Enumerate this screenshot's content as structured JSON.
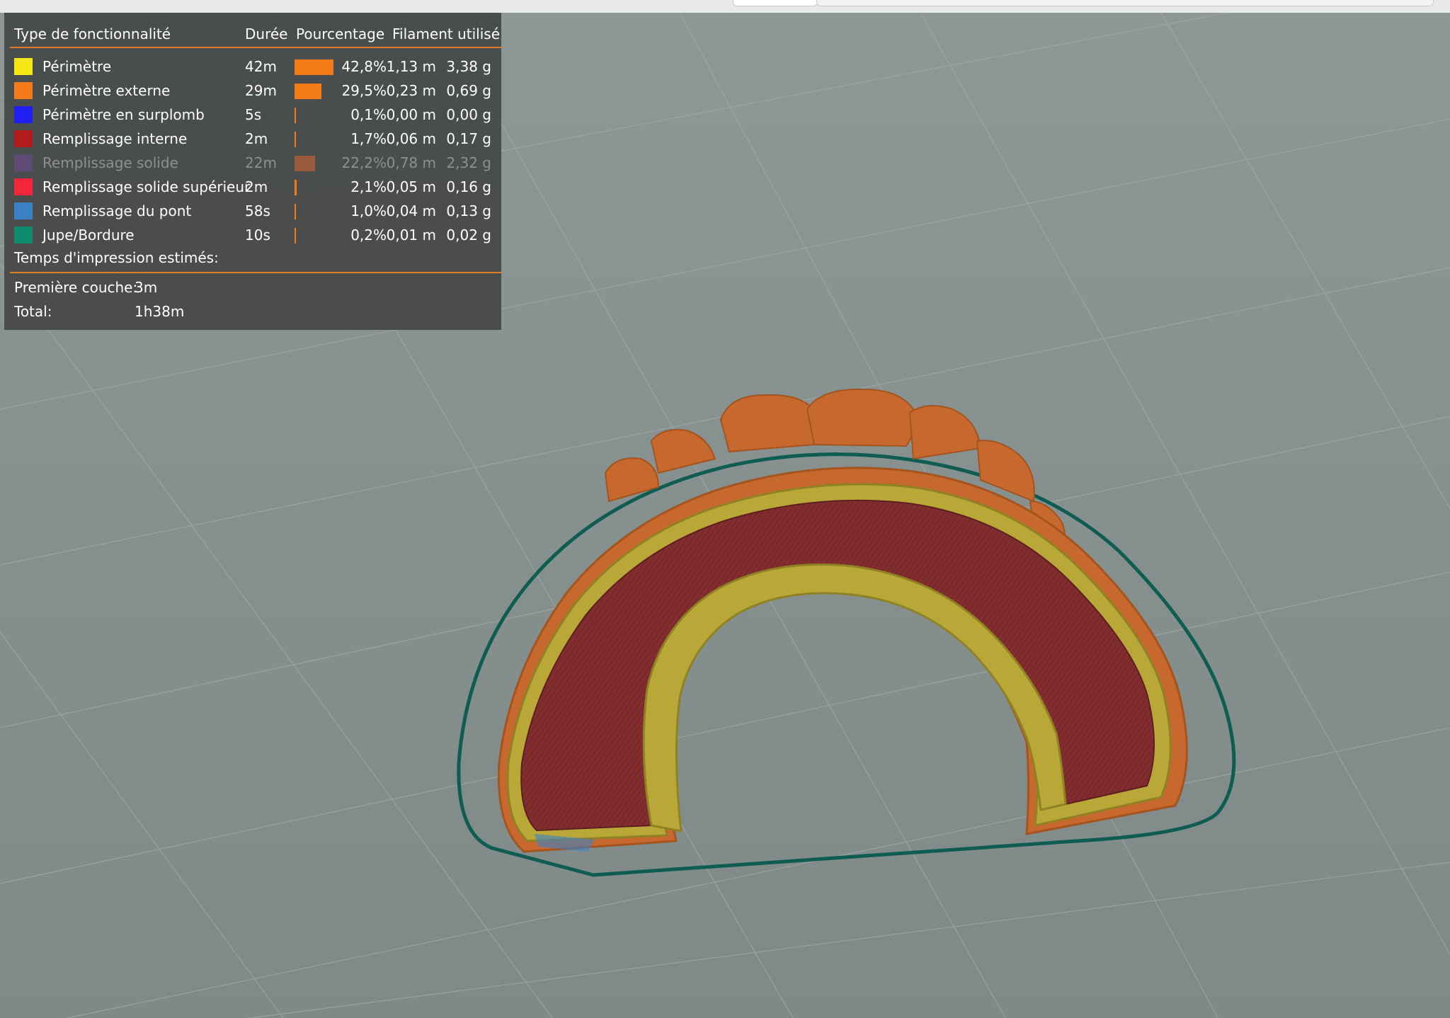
{
  "legend": {
    "headers": {
      "type": "Type de fonctionnalité",
      "duration": "Durée",
      "percentage": "Pourcentage",
      "filament": "Filament utilisé"
    },
    "rows": [
      {
        "color": "#f5e614",
        "name": "Périmètre",
        "duration": "42m",
        "percent_value": 42.8,
        "percent": "42,8%",
        "length": "1,13 m",
        "weight": "3,38 g",
        "dimmed": false
      },
      {
        "color": "#f57a18",
        "name": "Périmètre externe",
        "duration": "29m",
        "percent_value": 29.5,
        "percent": "29,5%",
        "length": "0,23 m",
        "weight": "0,69 g",
        "dimmed": false
      },
      {
        "color": "#2020f5",
        "name": "Périmètre en surplomb",
        "duration": "5s",
        "percent_value": 0.1,
        "percent": "0,1%",
        "length": "0,00 m",
        "weight": "0,00 g",
        "dimmed": false
      },
      {
        "color": "#b01c1c",
        "name": "Remplissage interne",
        "duration": "2m",
        "percent_value": 1.7,
        "percent": "1,7%",
        "length": "0,06 m",
        "weight": "0,17 g",
        "dimmed": false
      },
      {
        "color": "#5e4a72",
        "name": "Remplissage solide",
        "duration": "22m",
        "percent_value": 22.2,
        "percent": "22,2%",
        "length": "0,78 m",
        "weight": "2,32 g",
        "dimmed": true
      },
      {
        "color": "#f5253a",
        "name": "Remplissage solide supérieur",
        "duration": "2m",
        "percent_value": 2.1,
        "percent": "2,1%",
        "length": "0,05 m",
        "weight": "0,16 g",
        "dimmed": false
      },
      {
        "color": "#3a82c4",
        "name": "Remplissage du pont",
        "duration": "58s",
        "percent_value": 1.0,
        "percent": "1,0%",
        "length": "0,04 m",
        "weight": "0,13 g",
        "dimmed": false
      },
      {
        "color": "#0e8a6c",
        "name": "Jupe/Bordure",
        "duration": "10s",
        "percent_value": 0.2,
        "percent": "0,2%",
        "length": "0,01 m",
        "weight": "0,02 g",
        "dimmed": false
      }
    ],
    "estimated_title": "Temps d'impression estimés:",
    "first_layer_label": "Première couche:",
    "first_layer_value": "3m",
    "total_label": "Total:",
    "total_value": "1h38m"
  },
  "colors": {
    "bed": "#8c9694",
    "grid": "#a9b2b0",
    "skirt": "#0f5c52",
    "external_perimeter": "#c7682e",
    "perimeter": "#b9a838",
    "infill": "#7c2a2c",
    "accent_rule": "#e07b28"
  }
}
